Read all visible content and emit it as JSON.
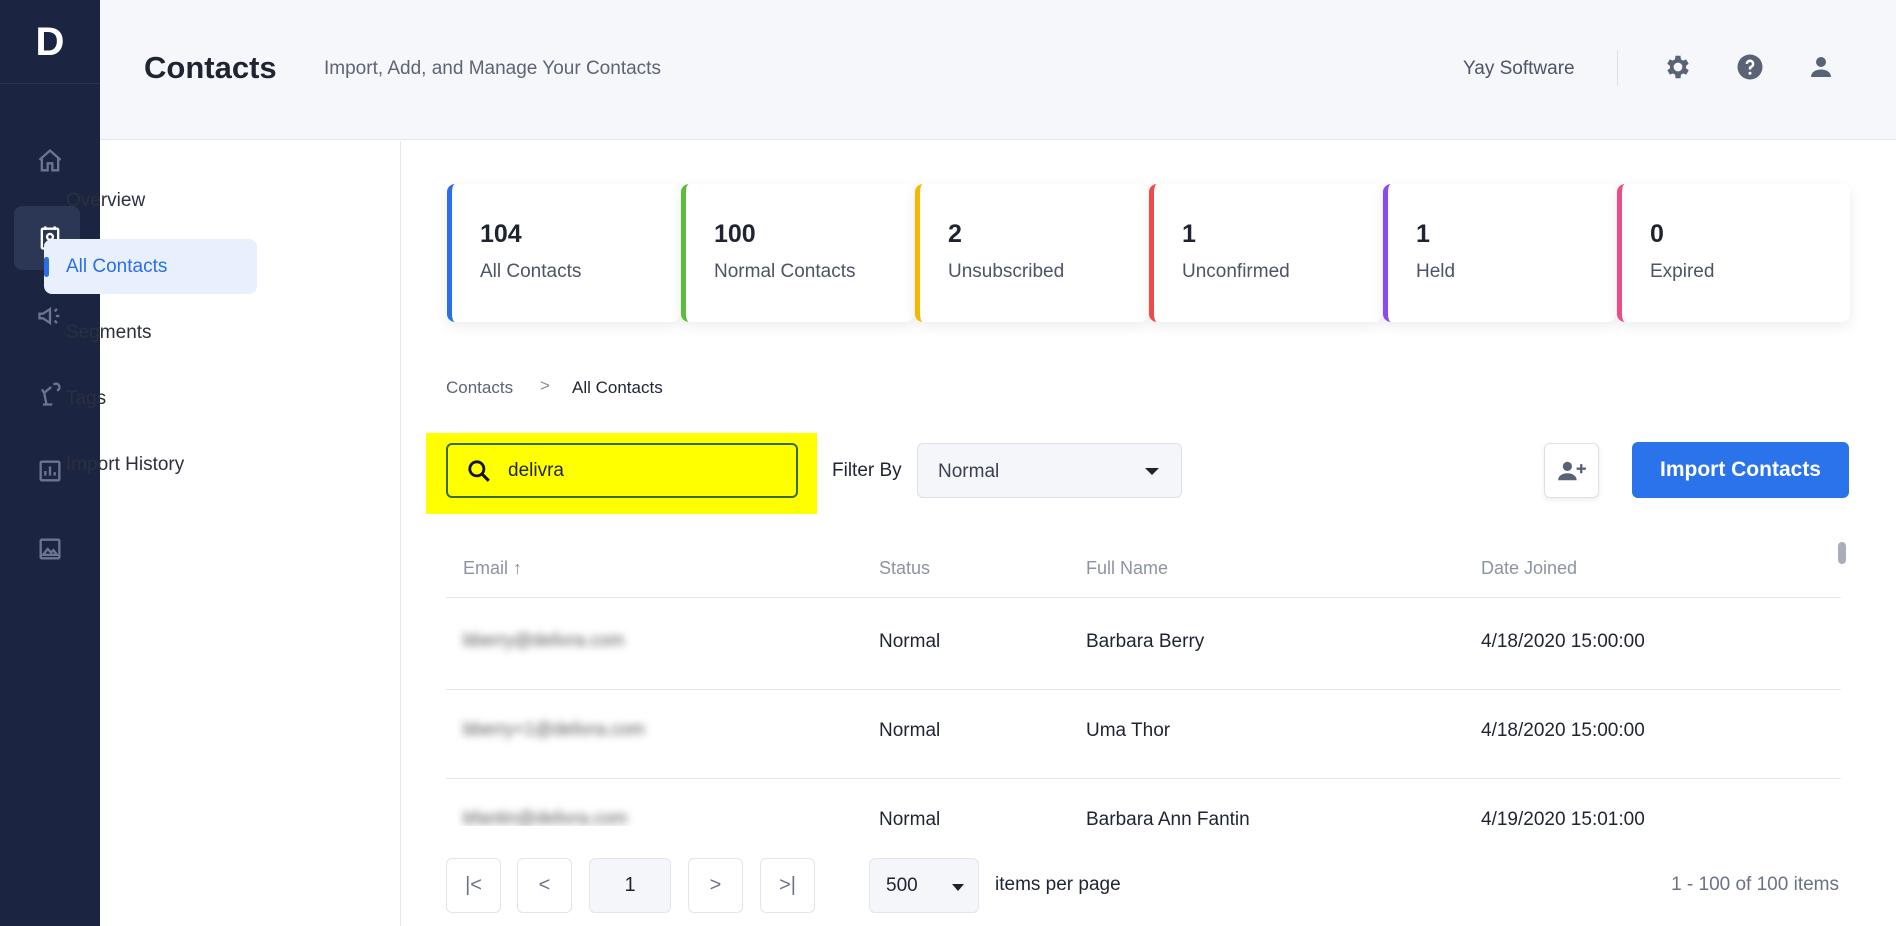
{
  "app": {
    "logo": "D",
    "rail": [
      {
        "icon": "home-icon"
      },
      {
        "icon": "contacts-icon",
        "active": true
      },
      {
        "icon": "megaphone-icon"
      },
      {
        "icon": "automation-icon"
      },
      {
        "icon": "chart-icon"
      },
      {
        "icon": "image-icon"
      }
    ]
  },
  "header": {
    "title": "Contacts",
    "subtitle": "Import, Add, and Manage Your Contacts",
    "org": "Yay Software",
    "icons": [
      "gear-icon",
      "help-icon",
      "user-icon"
    ]
  },
  "subnav": {
    "items": [
      {
        "label": "Overview"
      },
      {
        "label": "All Contacts",
        "active": true
      },
      {
        "label": "Segments"
      },
      {
        "label": "Tags"
      },
      {
        "label": "Import History"
      }
    ]
  },
  "stats": [
    {
      "value": "104",
      "label": "All Contacts",
      "color": "#2a6ee8"
    },
    {
      "value": "100",
      "label": "Normal Contacts",
      "color": "#5cbd3c"
    },
    {
      "value": "2",
      "label": "Unsubscribed",
      "color": "#f5b800"
    },
    {
      "value": "1",
      "label": "Unconfirmed",
      "color": "#ee4b4b"
    },
    {
      "value": "1",
      "label": "Held",
      "color": "#8c4bf0"
    },
    {
      "value": "0",
      "label": "Expired",
      "color": "#ee4b8a"
    }
  ],
  "breadcrumb": {
    "parent": "Contacts",
    "separator": ">",
    "current": "All Contacts"
  },
  "toolbar": {
    "search_value": "delivra",
    "filter_label": "Filter By",
    "filter_value": "Normal",
    "import_label": "Import Contacts"
  },
  "table": {
    "columns": [
      "Email ↑",
      "Status",
      "Full Name",
      "Date Joined"
    ],
    "rows": [
      {
        "email": "bberry@delivra.com",
        "status": "Normal",
        "name": "Barbara Berry",
        "date": "4/18/2020 15:00:00"
      },
      {
        "email": "bberry+1@delivra.com",
        "status": "Normal",
        "name": "Uma Thor",
        "date": "4/18/2020 15:00:00"
      },
      {
        "email": "bfantin@delivra.com",
        "status": "Normal",
        "name": "Barbara Ann Fantin",
        "date": "4/19/2020 15:01:00"
      }
    ]
  },
  "pagination": {
    "first": "|<",
    "prev": "<",
    "current": "1",
    "next": ">",
    "last": ">|",
    "per_page": "500",
    "per_page_label": "items per page",
    "range": "1 - 100 of 100 items"
  }
}
